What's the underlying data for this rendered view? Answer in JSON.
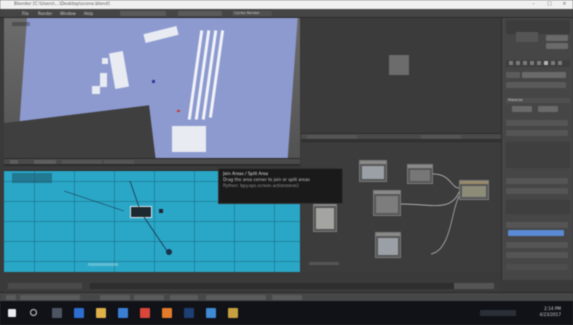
{
  "window": {
    "title": "Blender [C:\\Users\\...\\Desktop\\scene.blend]",
    "minimize_icon": "minimize-icon",
    "maximize_icon": "maximize-icon",
    "close_icon": "close-icon"
  },
  "info_header": {
    "menus": [
      "File",
      "Render",
      "Window",
      "Help"
    ],
    "engine": "Cycles Render"
  },
  "tooltip": {
    "title": "Join Areas / Split Area",
    "body_line1": "Drag the area corner to join or split areas",
    "body_line2": "Python: bpy.ops.screen.actionzone()"
  },
  "properties": {
    "section_label": "Material"
  },
  "taskbar": {
    "time": "2:14 PM",
    "date": "4/23/2017",
    "icons": [
      "windows-start-icon",
      "search-icon",
      "task-view-icon",
      "edge-icon",
      "explorer-icon",
      "store-icon",
      "chrome-icon",
      "blender-icon",
      "photoshop-icon",
      "mail-icon",
      "folder-icon"
    ]
  },
  "colors": {
    "uv_background": "#2aa7c7",
    "floor": "#8d9ad0",
    "active_field": "#5b8ad6"
  }
}
